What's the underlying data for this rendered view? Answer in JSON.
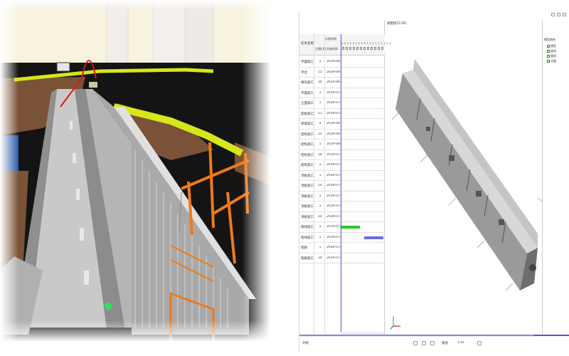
{
  "gantt": {
    "header": {
      "name_col": "任务名称",
      "duration_col": "工期(天)",
      "start_col": "开始时间",
      "group": "计划时间"
    },
    "date_strip": "2 2 2 2 2 2 2 2 2 1 1 1 1 1 1 1 1 1",
    "rows": [
      {
        "name": "平面施工",
        "dur": "1",
        "date": "2019-06-05"
      },
      {
        "name": "平台",
        "dur": "15",
        "date": "2019-06-05"
      },
      {
        "name": "横向施工",
        "dur": "20",
        "date": "2019-06-05"
      },
      {
        "name": "平面施工",
        "dur": "1",
        "date": "2019-07-15"
      },
      {
        "name": "立面施工",
        "dur": "1",
        "date": "2019-07-15"
      },
      {
        "name": "底板施工",
        "dur": "11",
        "date": "2019-07-15"
      },
      {
        "name": "侧墙施工",
        "dur": "4",
        "date": "2019-06-03"
      },
      {
        "name": "结构施工",
        "dur": "25",
        "date": "2019-06-04"
      },
      {
        "name": "结构施工",
        "dur": "1",
        "date": "2019-06-04"
      },
      {
        "name": "结构施工",
        "dur": "16",
        "date": "2019-07-05"
      },
      {
        "name": "结构施工",
        "dur": "1",
        "date": "2019-07-15"
      },
      {
        "name": "顶板施工",
        "dur": "1",
        "date": "2019-07-15"
      },
      {
        "name": "顶板施工",
        "dur": "14",
        "date": "2019-07-15"
      },
      {
        "name": "顶板施工",
        "dur": "1",
        "date": "2019-07-25"
      },
      {
        "name": "顶板施工",
        "dur": "1",
        "date": "2019-07-25"
      },
      {
        "name": "顶板施工",
        "dur": "10",
        "date": "2019-07-25"
      },
      {
        "name": "管线施工",
        "dur": "1",
        "date": "2019-07-25"
      },
      {
        "name": "管线施工",
        "dur": "1",
        "date": "2019-07-25"
      },
      {
        "name": "管廊",
        "dur": "1",
        "date": "2019-07-25"
      },
      {
        "name": "管廊施工",
        "dur": "24",
        "date": "2019-07-25"
      }
    ],
    "bars": [
      {
        "row": 16,
        "start": 0.02,
        "end": 0.45,
        "color": "#22cc22"
      },
      {
        "row": 17,
        "start": 0.55,
        "end": 1.0,
        "color": "#6b6ae0"
      }
    ]
  },
  "viewport": {
    "title": "视图窗口(3D)"
  },
  "tree": {
    "root": "模型结构",
    "items": [
      "模型",
      "结构",
      "管线",
      "设备"
    ]
  },
  "statusbar": {
    "left": "开始",
    "center": "播放",
    "speed": "1.0x"
  },
  "colors": {
    "yellow_wall": "#d7e61a",
    "orange_frame": "#f07a18",
    "ground": "#7a5238",
    "timeline": "#5a50d6"
  }
}
